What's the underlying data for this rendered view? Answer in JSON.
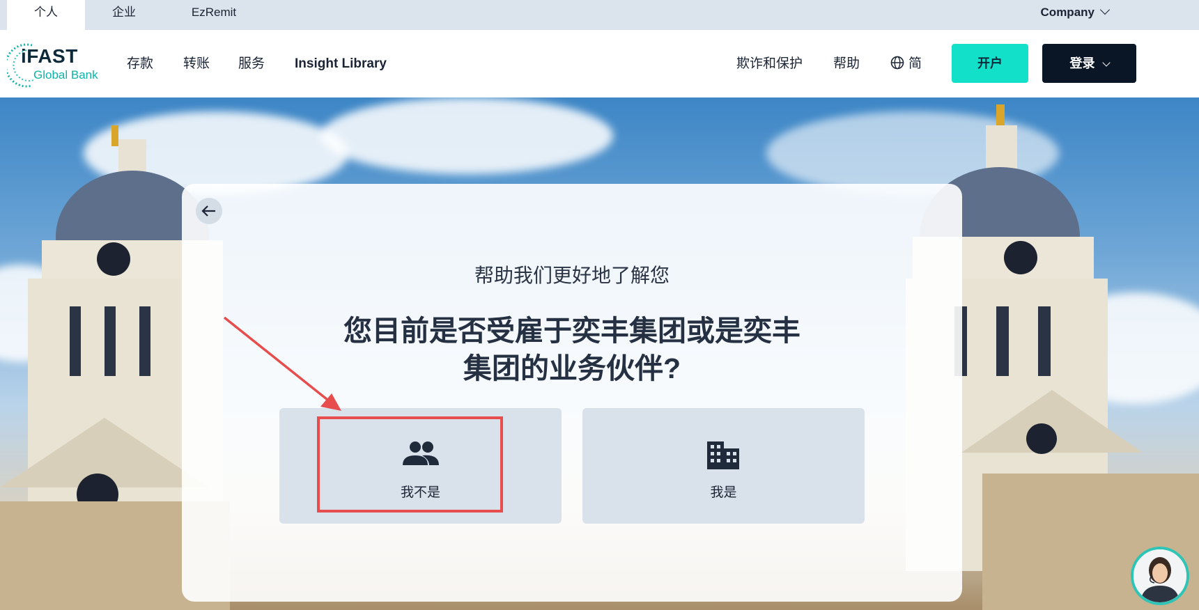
{
  "topbar": {
    "tabs": [
      {
        "label": "个人",
        "active": true
      },
      {
        "label": "企业",
        "active": false
      },
      {
        "label": "EzRemit",
        "active": false
      }
    ],
    "company": "Company"
  },
  "logo": {
    "main": "iFAST",
    "sub": "Global Bank"
  },
  "nav": {
    "left_links": [
      "存款",
      "转账",
      "服务",
      "Insight Library"
    ],
    "fraud": "欺诈和保护",
    "help": "帮助",
    "language": "简",
    "open_account": "开户",
    "login": "登录"
  },
  "card": {
    "subtitle": "帮助我们更好地了解您",
    "question_line1": "您目前是否受雇于奕丰集团或是奕丰",
    "question_line2": "集团的业务伙伴?",
    "options": [
      {
        "label": "我不是",
        "icon": "people-icon"
      },
      {
        "label": "我是",
        "icon": "building-icon"
      }
    ]
  },
  "colors": {
    "accent": "#12e0c8",
    "dark_button": "#0a1526",
    "highlight_box": "#e84d4d"
  }
}
